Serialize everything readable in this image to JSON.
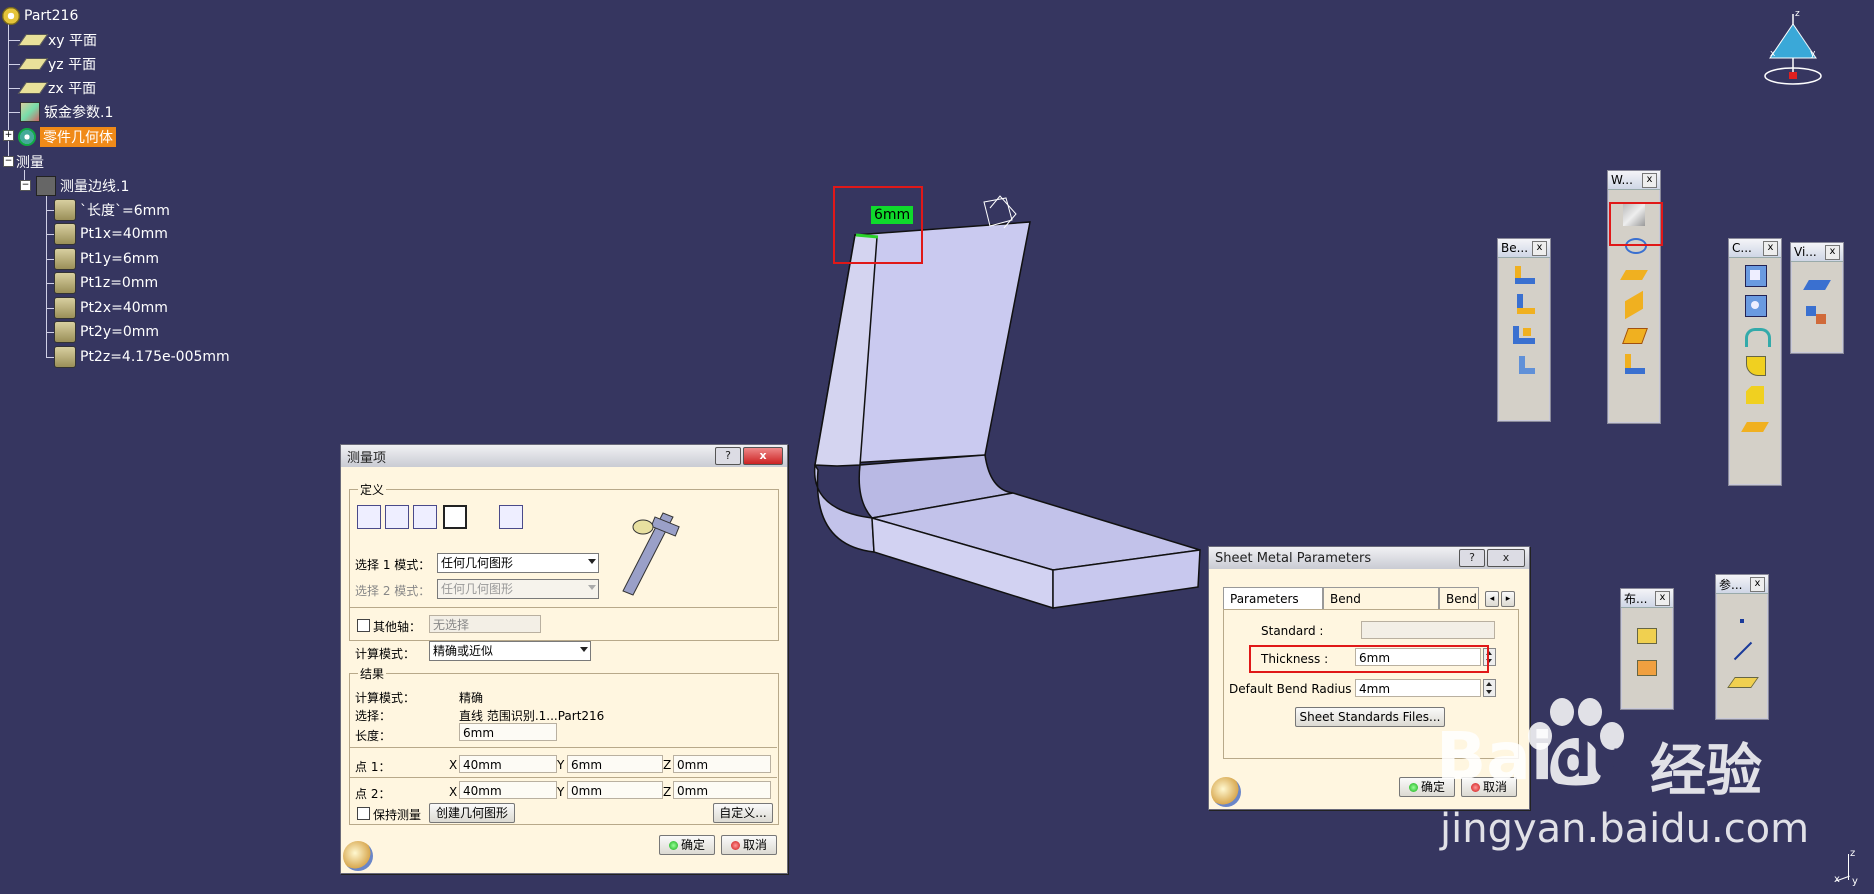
{
  "tree": {
    "root": "Part216",
    "items": [
      "xy 平面",
      "yz 平面",
      "zx 平面",
      "钣金参数.1",
      "零件几何体",
      "测量",
      "测量边线.1"
    ],
    "params": [
      "`长度`=6mm",
      "Pt1x=40mm",
      "Pt1y=6mm",
      "Pt1z=0mm",
      "Pt2x=40mm",
      "Pt2y=0mm",
      "Pt2z=4.175e-005mm"
    ]
  },
  "viewport": {
    "dimension_label": "6mm"
  },
  "toolbars": {
    "bend": "Be...",
    "walls": "W...",
    "cutting": "C...",
    "view": "Vi...",
    "layout": "布...",
    "ref": "参...",
    "close": "x"
  },
  "measure_dialog": {
    "title": "测量项",
    "help": "?",
    "close": "x",
    "definition_legend": "定义",
    "sel1_label": "选择 1 模式：",
    "sel1_value": "任何几何图形",
    "sel2_label": "选择 2 模式：",
    "sel2_value": "任何几何图形",
    "other_axis_label": "其他轴：",
    "other_axis_value": "无选择",
    "calc_mode_label": "计算模式：",
    "calc_mode_value": "精确或近似",
    "results_legend": "结果",
    "res_calc_mode_label": "计算模式：",
    "res_calc_mode_value": "精确",
    "res_selection_label": "选择：",
    "res_selection_value": "直线 范围识别.1...Part216",
    "length_label": "长度：",
    "length_value": "6mm",
    "point1_label": "点 1：",
    "point2_label": "点 2：",
    "x_label": "X",
    "y_label": "Y",
    "z_label": "Z",
    "p1x": "40mm",
    "p1y": "6mm",
    "p1z": "0mm",
    "p2x": "40mm",
    "p2y": "0mm",
    "p2z": "0mm",
    "keep_label": "保持测量",
    "create_geo": "创建几何图形",
    "customize": "自定义...",
    "ok": "确定",
    "cancel": "取消"
  },
  "sheet_dialog": {
    "title": "Sheet Metal Parameters",
    "help": "?",
    "close": "x",
    "tabs": [
      "Parameters",
      "Bend Extremities",
      "Bend"
    ],
    "standard_label": "Standard :",
    "standard_value": "",
    "thickness_label": "Thickness :",
    "thickness_value": "6mm",
    "radius_label": "Default Bend Radius :",
    "radius_value": "4mm",
    "files_button": "Sheet Standards Files...",
    "ok": "确定",
    "cancel": "取消"
  },
  "watermark": {
    "brand_a": "Bai",
    "brand_b": "du",
    "brand_cn": "经验",
    "url": "jingyan.baidu.com"
  },
  "axis": {
    "x": "x",
    "y": "y",
    "z": "z"
  }
}
